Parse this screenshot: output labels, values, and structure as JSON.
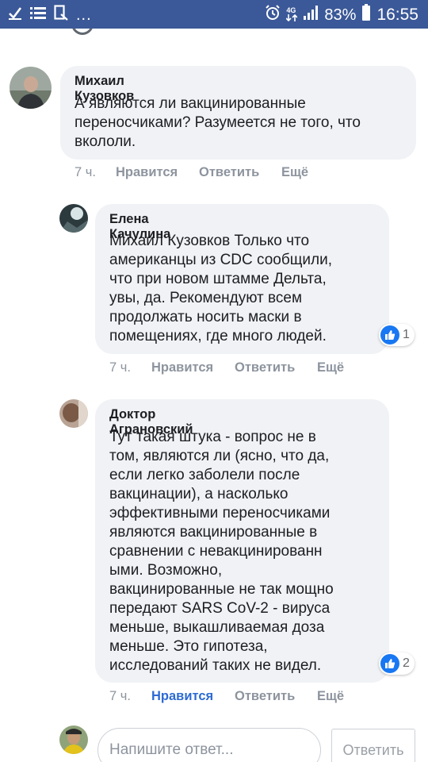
{
  "status_bar": {
    "time": "16:55",
    "battery_percent": "83%",
    "network": "4G",
    "left_icons": [
      "check-icon",
      "list-icon",
      "document-icon",
      "more-dots"
    ],
    "more": "...",
    "background": "#3b5998"
  },
  "comments": [
    {
      "author": "Михаил Кузовков",
      "lines": [
        "А являются ли вакцинированные",
        "переносчиками? Разумеется не того, что",
        "вкололи."
      ],
      "time": "7 ч.",
      "like": "Нравится",
      "reply": "Ответить",
      "more": "Ещё"
    },
    {
      "author": "Елена Качулина",
      "lines": [
        "Михаил Кузовков Только что",
        "американцы из CDC сообщили,",
        "что при новом штамме Дельта,",
        "увы, да. Рекомендуют всем",
        "продолжать носить маски в",
        "помещениях, где много людей."
      ],
      "time": "7 ч.",
      "like": "Нравится",
      "reply": "Ответить",
      "more": "Ещё",
      "reaction_count": "1"
    },
    {
      "author": "Доктор Аграновский",
      "lines": [
        "Тут такая штука - вопрос не в",
        "том, являются ли (ясно, что да,",
        "если легко заболели после",
        "вакцинации), а насколько",
        "эффективными переносчиками",
        "являются вакцинированные в",
        "сравнении с невакцинированн",
        "ыми. Возможно,",
        "вакцинированные не так мощно",
        "передают SARS CoV-2 - вируса",
        "меньше, выкашливаемая доза",
        "меньше. Это гипотеза,",
        "исследований таких не видел."
      ],
      "time": "7 ч.",
      "like": "Нравится",
      "reply": "Ответить",
      "more": "Ещё",
      "reaction_count": "2",
      "liked_by_viewer": true
    }
  ],
  "composer": {
    "placeholder": "Напишите ответ...",
    "send_label": "Ответить"
  },
  "colors": {
    "bubble": "#f0f2f5",
    "liked": "#2d6bd3",
    "muted": "#8d949e",
    "like_badge": "#1877f2"
  }
}
